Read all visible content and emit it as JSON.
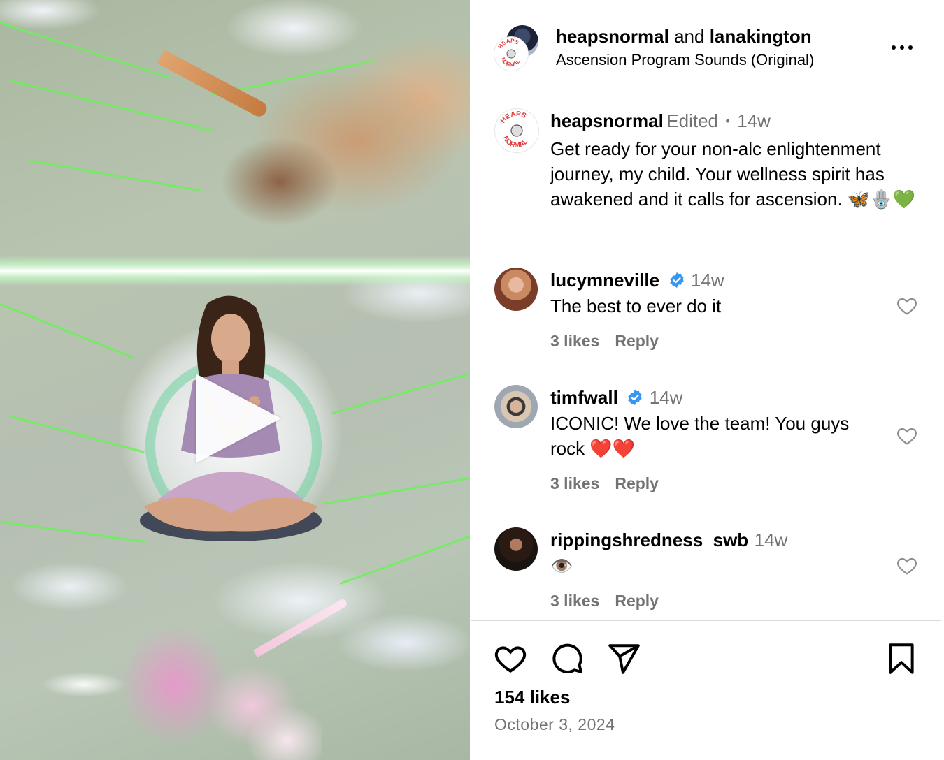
{
  "post": {
    "owner": "heapsnormal",
    "connector": "and",
    "collaborator": "lanakington",
    "audio": "Ascension Program Sounds (Original)",
    "logo_text": "HEAPS NORMAL"
  },
  "caption": {
    "username": "heapsnormal",
    "edited": "Edited",
    "separator": "•",
    "time": "14w",
    "text": "Get ready for your non-alc enlightenment journey, my child. Your wellness spirit has awakened and it calls for ascension. 🦋🪬💚"
  },
  "comments": [
    {
      "username": "lucymneville",
      "verified": true,
      "time": "14w",
      "text": "The best to ever do it",
      "likes": "3 likes",
      "reply": "Reply"
    },
    {
      "username": "timfwall",
      "verified": true,
      "time": "14w",
      "text": "ICONIC! We love the team! You guys rock ❤️❤️",
      "likes": "3 likes",
      "reply": "Reply"
    },
    {
      "username": "rippingshredness_swb",
      "verified": false,
      "time": "14w",
      "text": "👁️",
      "likes": "3 likes",
      "reply": "Reply"
    }
  ],
  "footer": {
    "likes": "154 likes",
    "date": "October 3, 2024"
  },
  "colors": {
    "verified": "#3797f0",
    "muted": "#737373",
    "divider": "#dbdbdb",
    "glow": "#6cf05a"
  },
  "icons": [
    "play-icon",
    "more-icon",
    "heart-icon",
    "comment-icon",
    "share-icon",
    "bookmark-icon",
    "verified-badge-icon"
  ]
}
